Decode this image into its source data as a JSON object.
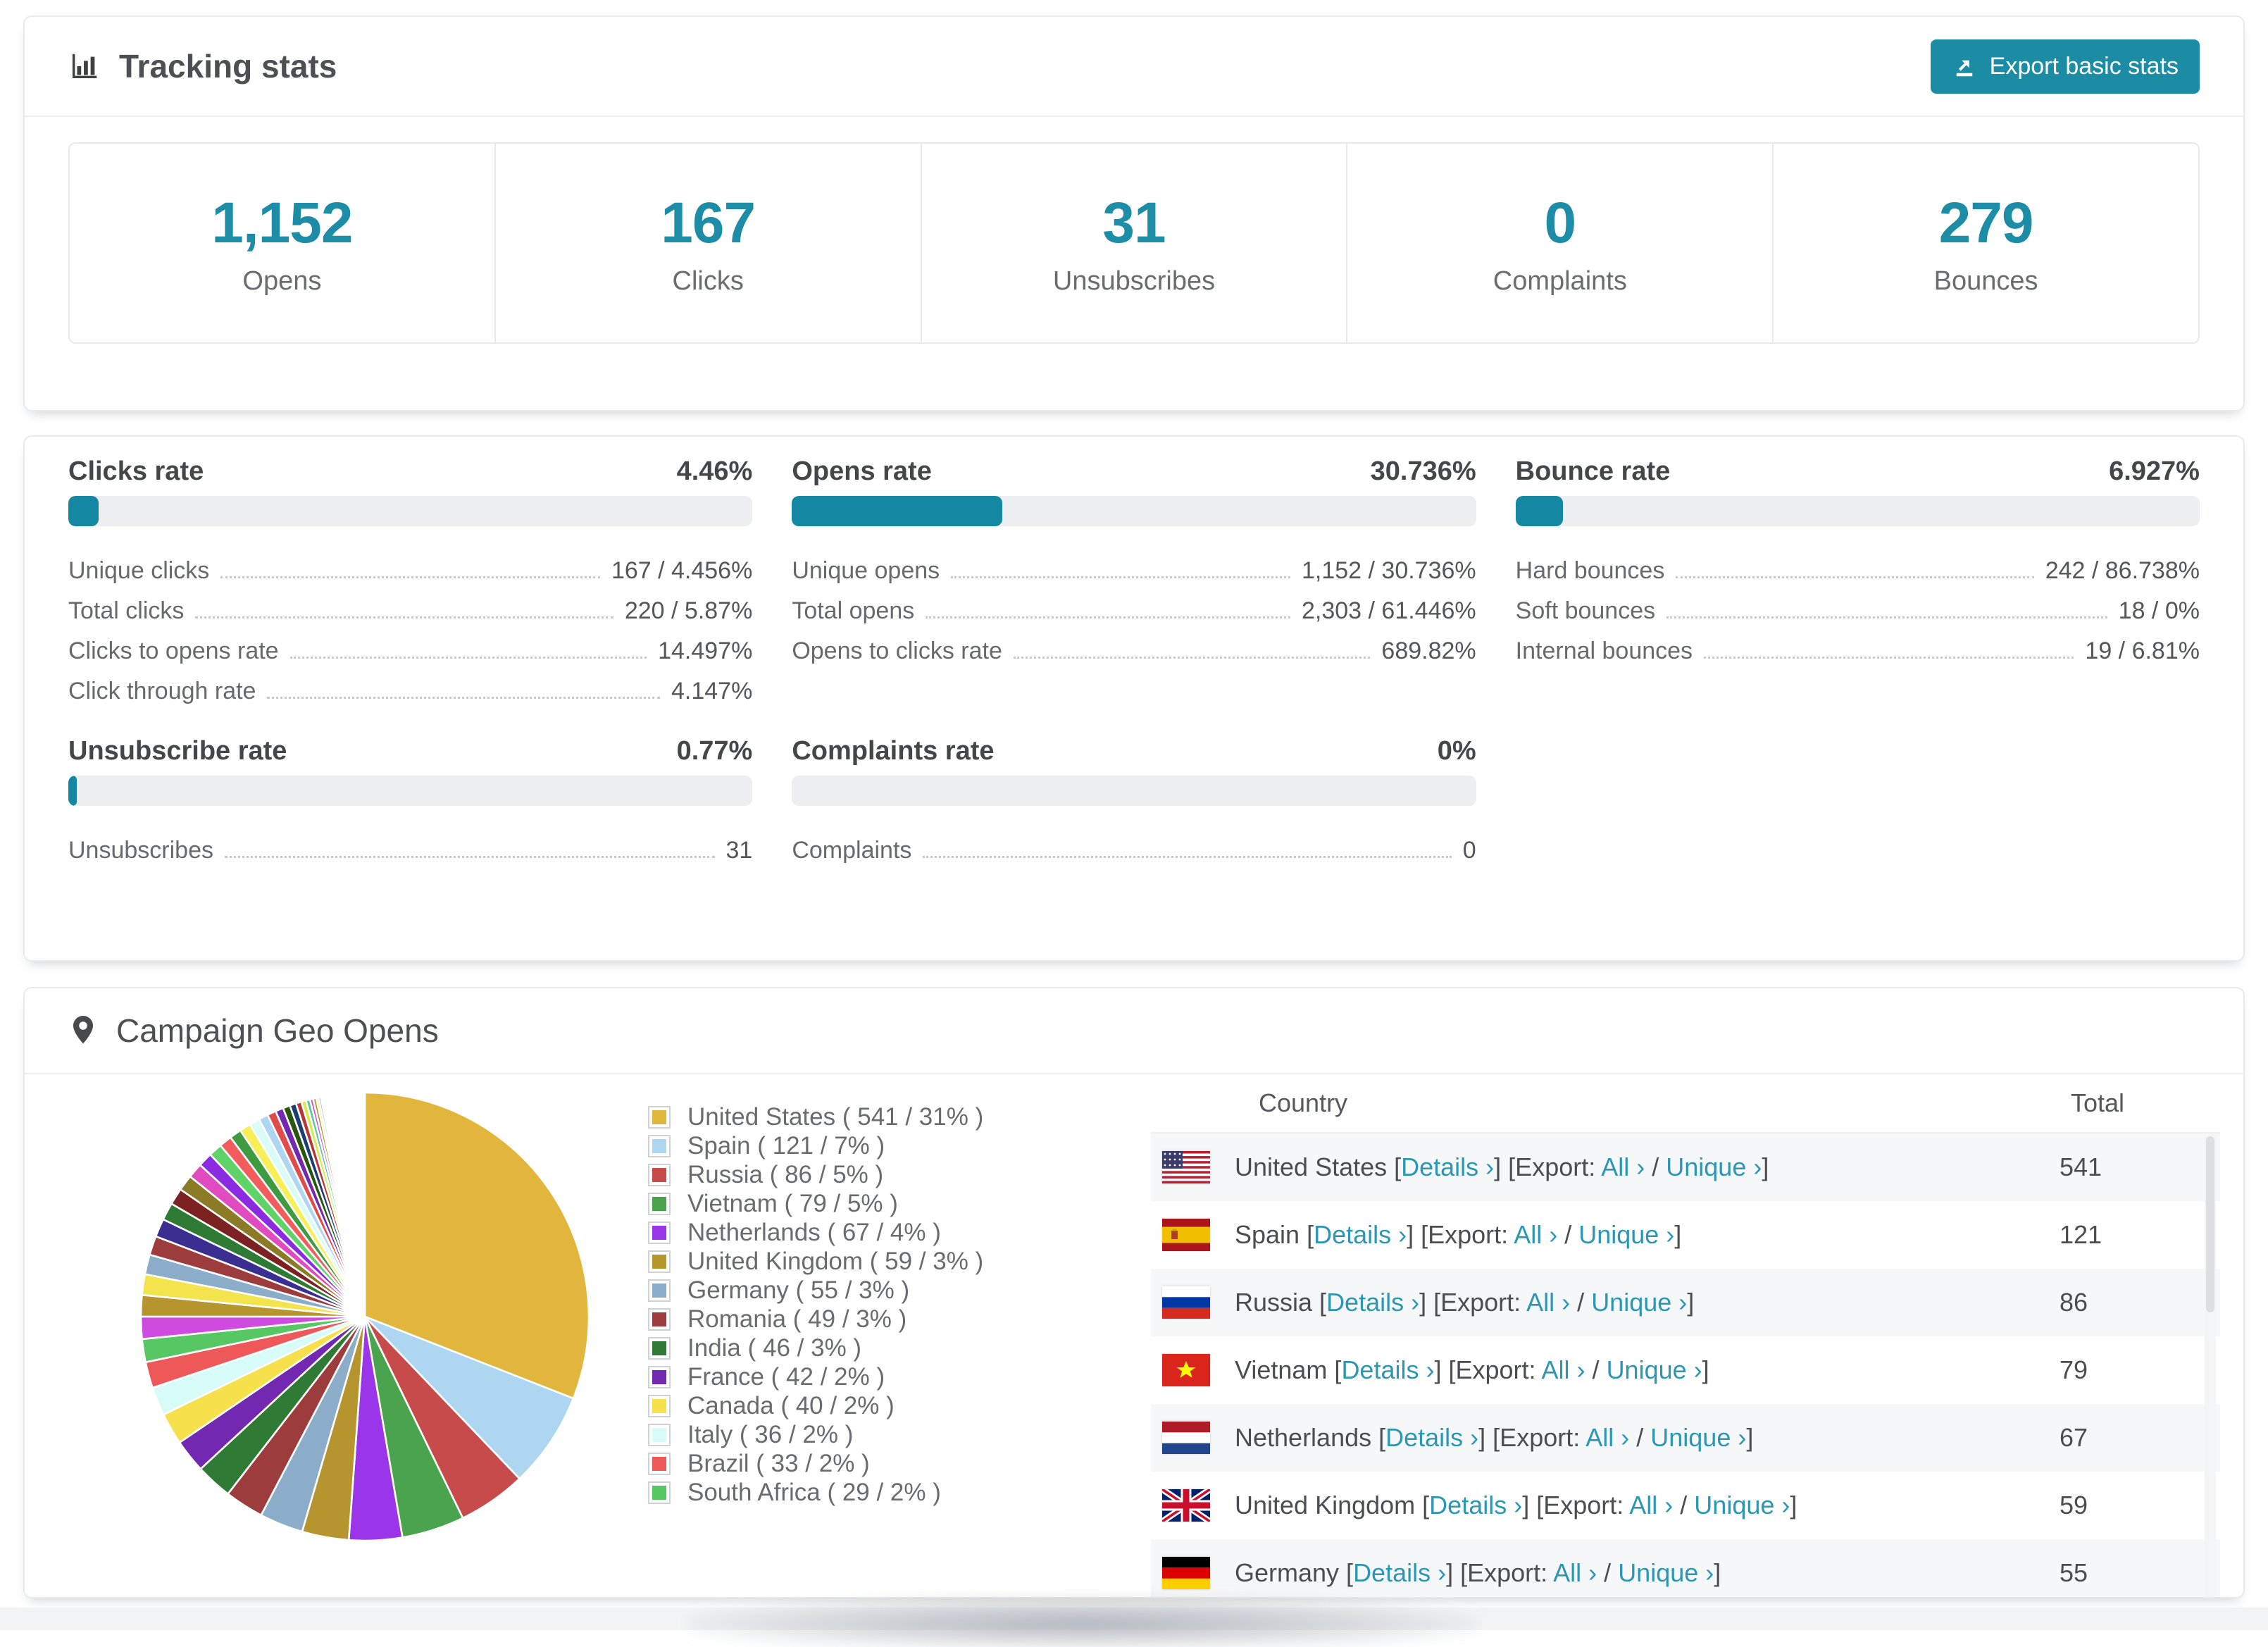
{
  "header": {
    "title": "Tracking stats",
    "export_button": "Export basic stats"
  },
  "summary_stats": [
    {
      "value": "1,152",
      "label": "Opens"
    },
    {
      "value": "167",
      "label": "Clicks"
    },
    {
      "value": "31",
      "label": "Unsubscribes"
    },
    {
      "value": "0",
      "label": "Complaints"
    },
    {
      "value": "279",
      "label": "Bounces"
    }
  ],
  "rates": [
    {
      "title": "Clicks rate",
      "percent_label": "4.46%",
      "bar_pct": 4.46,
      "rows": [
        {
          "label": "Unique clicks",
          "value": "167 / 4.456%"
        },
        {
          "label": "Total clicks",
          "value": "220 / 5.87%"
        },
        {
          "label": "Clicks to opens rate",
          "value": "14.497%"
        },
        {
          "label": "Click through rate",
          "value": "4.147%"
        }
      ]
    },
    {
      "title": "Opens rate",
      "percent_label": "30.736%",
      "bar_pct": 30.736,
      "rows": [
        {
          "label": "Unique opens",
          "value": "1,152 / 30.736%"
        },
        {
          "label": "Total opens",
          "value": "2,303 / 61.446%"
        },
        {
          "label": "Opens to clicks rate",
          "value": "689.82%"
        }
      ]
    },
    {
      "title": "Bounce rate",
      "percent_label": "6.927%",
      "bar_pct": 6.927,
      "rows": [
        {
          "label": "Hard bounces",
          "value": "242 / 86.738%"
        },
        {
          "label": "Soft bounces",
          "value": "18 / 0%"
        },
        {
          "label": "Internal bounces",
          "value": "19 / 6.81%"
        }
      ]
    },
    {
      "title": "Unsubscribe rate",
      "percent_label": "0.77%",
      "bar_pct": 0.77,
      "rows": [
        {
          "label": "Unsubscribes",
          "value": "31"
        }
      ]
    },
    {
      "title": "Complaints rate",
      "percent_label": "0%",
      "bar_pct": 0,
      "rows": [
        {
          "label": "Complaints",
          "value": "0"
        }
      ]
    }
  ],
  "geo": {
    "title": "Campaign Geo Opens",
    "table": {
      "columns": [
        "Country",
        "Total"
      ],
      "row_links": {
        "details_label": "Details",
        "export_label": "Export:",
        "all_label": "All",
        "unique_label": "Unique",
        "chevron": "›"
      },
      "rows": [
        {
          "country": "United States",
          "flag": "us",
          "total": "541"
        },
        {
          "country": "Spain",
          "flag": "es",
          "total": "121"
        },
        {
          "country": "Russia",
          "flag": "ru",
          "total": "86"
        },
        {
          "country": "Vietnam",
          "flag": "vn",
          "total": "79"
        },
        {
          "country": "Netherlands",
          "flag": "nl",
          "total": "67"
        },
        {
          "country": "United Kingdom",
          "flag": "gb",
          "total": "59"
        },
        {
          "country": "Germany",
          "flag": "de",
          "total": "55"
        }
      ]
    }
  },
  "chart_data": {
    "type": "pie",
    "title": "Campaign Geo Opens",
    "legend_position": "right",
    "start_angle_deg": 0,
    "direction": "clockwise",
    "entries": [
      {
        "name": "United States",
        "value": 541,
        "pct": 31,
        "color": "#e2b63c"
      },
      {
        "name": "Spain",
        "value": 121,
        "pct": 7,
        "color": "#aed6f1"
      },
      {
        "name": "Russia",
        "value": 86,
        "pct": 5,
        "color": "#c74b4b"
      },
      {
        "name": "Vietnam",
        "value": 79,
        "pct": 5,
        "color": "#4aa34d"
      },
      {
        "name": "Netherlands",
        "value": 67,
        "pct": 4,
        "color": "#9a35ea"
      },
      {
        "name": "United Kingdom",
        "value": 59,
        "pct": 3,
        "color": "#b7952e"
      },
      {
        "name": "Germany",
        "value": 55,
        "pct": 3,
        "color": "#8cadc9"
      },
      {
        "name": "Romania",
        "value": 49,
        "pct": 3,
        "color": "#9d3c3c"
      },
      {
        "name": "India",
        "value": 46,
        "pct": 3,
        "color": "#2f7a35"
      },
      {
        "name": "France",
        "value": 42,
        "pct": 2,
        "color": "#7228b0"
      },
      {
        "name": "Canada",
        "value": 40,
        "pct": 2,
        "color": "#f6e04b"
      },
      {
        "name": "Italy",
        "value": 36,
        "pct": 2,
        "color": "#d7fcf8"
      },
      {
        "name": "Brazil",
        "value": 33,
        "pct": 2,
        "color": "#ef5858"
      },
      {
        "name": "South Africa",
        "value": 29,
        "pct": 2,
        "color": "#57c763"
      }
    ],
    "other_slices_estimated": [
      28,
      27,
      26,
      25,
      24,
      23,
      22,
      21,
      20,
      19,
      18,
      17,
      16,
      15,
      14,
      13,
      12,
      11,
      10,
      9,
      8,
      7,
      6,
      5,
      4,
      4,
      3,
      3,
      2,
      2,
      2,
      2,
      2,
      2,
      2,
      2,
      1,
      1,
      1,
      1,
      1,
      1,
      1,
      1,
      1,
      1,
      1,
      1,
      1,
      1,
      1,
      1,
      1,
      1,
      1,
      1,
      1,
      1,
      1,
      1,
      1,
      1,
      1,
      1,
      1,
      1,
      1,
      1,
      1,
      1,
      1,
      1,
      1,
      1,
      1
    ],
    "other_colors_cycle": [
      "#cf4be0",
      "#b7952e",
      "#f3e44e",
      "#8cadc9",
      "#9d3c3c",
      "#3a2f90",
      "#2f7a35",
      "#7c2222",
      "#8b7b26",
      "#e04cc0",
      "#8a2be2",
      "#5fd268",
      "#f25c5c",
      "#3f9b42",
      "#f6ef57",
      "#dafcf8",
      "#aed6f1",
      "#e04c4c",
      "#7228b0",
      "#28560f",
      "#1b3f73",
      "#b73737",
      "#d9e94c",
      "#57c7a0"
    ],
    "total_estimated": 1745
  },
  "accent": {
    "teal": "#1b8ca4",
    "link": "#2d96b2"
  }
}
